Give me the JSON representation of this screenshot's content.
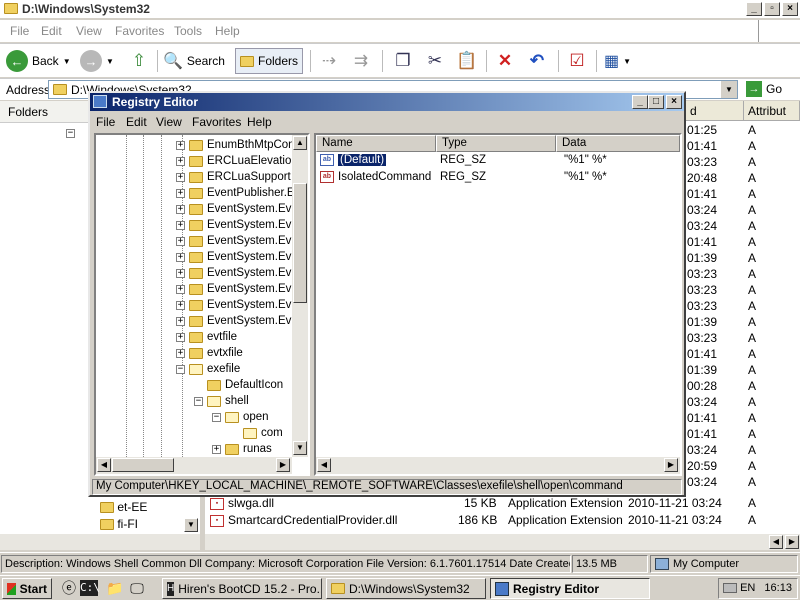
{
  "explorer": {
    "title": "D:\\Windows\\System32",
    "menu": [
      "File",
      "Edit",
      "View",
      "Favorites",
      "Tools",
      "Help"
    ],
    "toolbar": {
      "back": "Back",
      "search": "Search",
      "folders": "Folders"
    },
    "address_label": "Address",
    "address_value": "D:\\Windows\\System32",
    "go_label": "Go",
    "folders_header": "Folders",
    "left_items": [
      "et-EE",
      "fi-FI"
    ],
    "columns": [
      "d",
      "Attribut"
    ],
    "date_rows": [
      {
        "date": "01:25",
        "attr": "A"
      },
      {
        "date": "01:41",
        "attr": "A"
      },
      {
        "date": "03:23",
        "attr": "A"
      },
      {
        "date": "20:48",
        "attr": "A"
      },
      {
        "date": "01:41",
        "attr": "A"
      },
      {
        "date": "03:24",
        "attr": "A"
      },
      {
        "date": "03:24",
        "attr": "A"
      },
      {
        "date": "01:41",
        "attr": "A"
      },
      {
        "date": "01:39",
        "attr": "A"
      },
      {
        "date": "03:23",
        "attr": "A"
      },
      {
        "date": "03:23",
        "attr": "A"
      },
      {
        "date": "03:23",
        "attr": "A"
      },
      {
        "date": "01:39",
        "attr": "A"
      },
      {
        "date": "03:23",
        "attr": "A"
      },
      {
        "date": "01:41",
        "attr": "A"
      },
      {
        "date": "01:39",
        "attr": "A"
      },
      {
        "date": "00:28",
        "attr": "A"
      },
      {
        "date": "03:24",
        "attr": "A"
      },
      {
        "date": "01:41",
        "attr": "A"
      },
      {
        "date": "01:41",
        "attr": "A"
      },
      {
        "date": "03:24",
        "attr": "A"
      },
      {
        "date": "20:59",
        "attr": "A"
      },
      {
        "date": "03:24",
        "attr": "A"
      }
    ],
    "files": [
      {
        "name": "slwga.dll",
        "size": "15 KB",
        "type": "Application Extension",
        "modified": "2010-11-21 03:24",
        "attr": "A"
      },
      {
        "name": "SmartcardCredentialProvider.dll",
        "size": "186 KB",
        "type": "Application Extension",
        "modified": "2010-11-21 03:24",
        "attr": "A"
      }
    ]
  },
  "registry": {
    "title": "Registry Editor",
    "menu": [
      "File",
      "Edit",
      "View",
      "Favorites",
      "Help"
    ],
    "tree": [
      {
        "label": "EnumBthMtpCon",
        "expanded": false
      },
      {
        "label": "ERCLuaElevatio",
        "expanded": false
      },
      {
        "label": "ERCLuaSupport",
        "expanded": false
      },
      {
        "label": "EventPublisher.E",
        "expanded": false
      },
      {
        "label": "EventSystem.Ev",
        "expanded": false
      },
      {
        "label": "EventSystem.Ev",
        "expanded": false
      },
      {
        "label": "EventSystem.Ev",
        "expanded": false
      },
      {
        "label": "EventSystem.Ev",
        "expanded": false
      },
      {
        "label": "EventSystem.Ev",
        "expanded": false
      },
      {
        "label": "EventSystem.Ev",
        "expanded": false
      },
      {
        "label": "EventSystem.Ev",
        "expanded": false
      },
      {
        "label": "EventSystem.Ev",
        "expanded": false
      },
      {
        "label": "evtfile",
        "expanded": false
      },
      {
        "label": "evtxfile",
        "expanded": false
      },
      {
        "label": "exefile",
        "expanded": true
      },
      {
        "label": "DefaultIcon",
        "expanded": false
      },
      {
        "label": "shell",
        "expanded": true
      },
      {
        "label": "open",
        "expanded": true
      },
      {
        "label": "com",
        "expanded": false
      },
      {
        "label": "runas",
        "expanded": false
      }
    ],
    "columns": [
      "Name",
      "Type",
      "Data"
    ],
    "values": [
      {
        "name": "(Default)",
        "type": "REG_SZ",
        "data": "\"%1\" %*"
      },
      {
        "name": "IsolatedCommand",
        "type": "REG_SZ",
        "data": "\"%1\" %*"
      }
    ],
    "status_path": "My Computer\\HKEY_LOCAL_MACHINE\\_REMOTE_SOFTWARE\\Classes\\exefile\\shell\\open\\command"
  },
  "statusbar": {
    "description": "Description: Windows Shell Common Dll Company: Microsoft Corporation File Version: 6.1.7601.17514 Date Created: 201",
    "size": "13.5 MB",
    "location": "My Computer"
  },
  "taskbar": {
    "start": "Start",
    "tasks": [
      "Hiren's BootCD 15.2 - Pro...",
      "D:\\Windows\\System32",
      "Registry Editor"
    ],
    "lang": "EN",
    "time": "16:13"
  }
}
